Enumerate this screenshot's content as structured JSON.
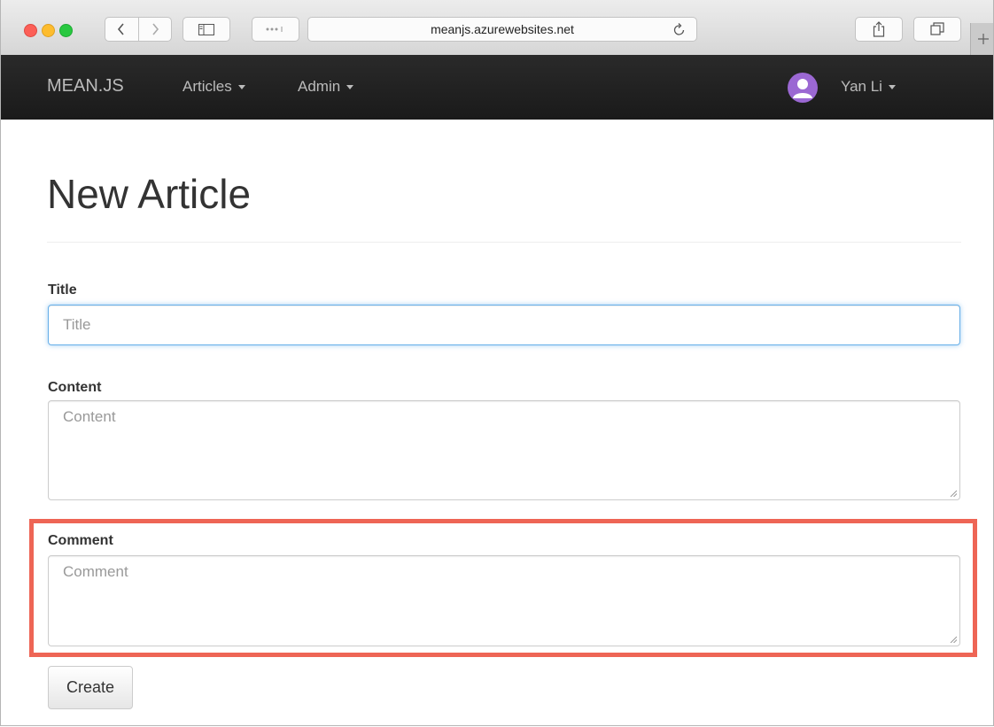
{
  "browser": {
    "url": "meanjs.azurewebsites.net"
  },
  "navbar": {
    "brand": "MEAN.JS",
    "links": [
      {
        "label": "Articles"
      },
      {
        "label": "Admin"
      }
    ],
    "user": {
      "name": "Yan Li"
    }
  },
  "page": {
    "title": "New Article"
  },
  "form": {
    "title": {
      "label": "Title",
      "placeholder": "Title",
      "value": ""
    },
    "content": {
      "label": "Content",
      "placeholder": "Content",
      "value": ""
    },
    "comment": {
      "label": "Comment",
      "placeholder": "Comment",
      "value": ""
    },
    "submit_label": "Create"
  },
  "colors": {
    "highlight": "#ee6555",
    "avatar": "#9b68d3",
    "navbar": "#222222",
    "focus": "#66afe9"
  }
}
